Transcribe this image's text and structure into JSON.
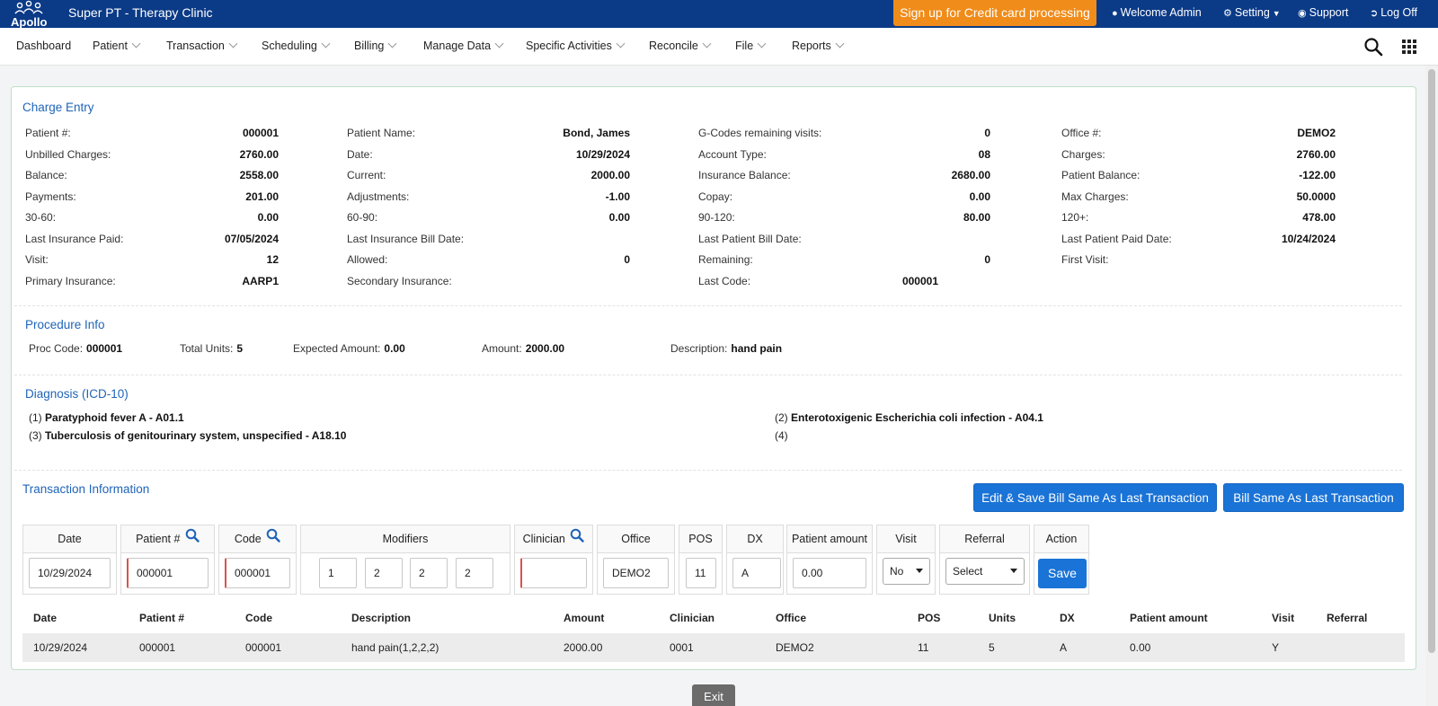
{
  "app": {
    "brand": "Apollo",
    "title": "Super PT - Therapy Clinic"
  },
  "topbar": {
    "signup_label": "Sign up for Credit card processing",
    "welcome": "Welcome Admin",
    "setting": "Setting",
    "support": "Support",
    "logoff": "Log Off"
  },
  "nav": [
    "Dashboard",
    "Patient",
    "Transaction",
    "Scheduling",
    "Billing",
    "Manage Data",
    "Specific Activities",
    "Reconcile",
    "File",
    "Reports"
  ],
  "charge_entry": {
    "title": "Charge Entry",
    "col1": [
      {
        "label": "Patient #:",
        "value": "000001"
      },
      {
        "label": "Unbilled Charges:",
        "value": "2760.00"
      },
      {
        "label": "Balance:",
        "value": "2558.00"
      },
      {
        "label": "Payments:",
        "value": "201.00"
      },
      {
        "label": "30-60:",
        "value": "0.00"
      },
      {
        "label": "Last Insurance Paid:",
        "value": "07/05/2024"
      },
      {
        "label": "Visit:",
        "value": "12"
      },
      {
        "label": "Primary Insurance:",
        "value": "AARP1"
      }
    ],
    "col2": [
      {
        "label": "Patient Name:",
        "value": "Bond, James"
      },
      {
        "label": "Date:",
        "value": "10/29/2024"
      },
      {
        "label": "Current:",
        "value": "2000.00"
      },
      {
        "label": "Adjustments:",
        "value": "-1.00"
      },
      {
        "label": "60-90:",
        "value": "0.00"
      },
      {
        "label": "Last Insurance Bill Date:",
        "value": ""
      },
      {
        "label": "Allowed:",
        "value": "0"
      },
      {
        "label": "Secondary Insurance:",
        "value": ""
      }
    ],
    "col3": [
      {
        "label": "G-Codes remaining visits:",
        "value": "0"
      },
      {
        "label": "Account Type:",
        "value": "08"
      },
      {
        "label": "Insurance Balance:",
        "value": "2680.00"
      },
      {
        "label": "Copay:",
        "value": "0.00"
      },
      {
        "label": "90-120:",
        "value": "80.00"
      },
      {
        "label": "Last Patient Bill Date:",
        "value": ""
      },
      {
        "label": "Remaining:",
        "value": "0"
      },
      {
        "label": "Last Code:",
        "value": "000001"
      }
    ],
    "col4": [
      {
        "label": "Office #:",
        "value": "DEMO2"
      },
      {
        "label": "Charges:",
        "value": "2760.00"
      },
      {
        "label": "Patient Balance:",
        "value": "-122.00"
      },
      {
        "label": "Max Charges:",
        "value": "50.0000"
      },
      {
        "label": "120+:",
        "value": "478.00"
      },
      {
        "label": "Last Patient Paid Date:",
        "value": "10/24/2024"
      },
      {
        "label": "First Visit:",
        "value": ""
      }
    ]
  },
  "procedure": {
    "title": "Procedure Info",
    "items": [
      {
        "label": "Proc Code:",
        "value": "000001"
      },
      {
        "label": "Total Units:",
        "value": "5"
      },
      {
        "label": "Expected Amount:",
        "value": "0.00"
      },
      {
        "label": "Amount:",
        "value": "2000.00"
      },
      {
        "label": "Description:",
        "value": "hand pain"
      }
    ]
  },
  "diagnosis": {
    "title": "Diagnosis (ICD-10)",
    "items": [
      {
        "num": "(1)",
        "text": "Paratyphoid fever A - A01.1"
      },
      {
        "num": "(2)",
        "text": "Enterotoxigenic Escherichia coli infection - A04.1"
      },
      {
        "num": "(3)",
        "text": "Tuberculosis of genitourinary system, unspecified - A18.10"
      },
      {
        "num": "(4)",
        "text": ""
      }
    ]
  },
  "transaction": {
    "title": "Transaction Information",
    "btn_edit_save": "Edit & Save Bill Same As Last Transaction",
    "btn_bill_same": "Bill Same As Last Transaction",
    "headers": {
      "date": "Date",
      "patient": "Patient #",
      "code": "Code",
      "modifiers": "Modifiers",
      "clinician": "Clinician",
      "office": "Office",
      "pos": "POS",
      "dx": "DX",
      "patient_amount": "Patient amount",
      "visit": "Visit",
      "referral": "Referral",
      "action": "Action"
    },
    "values": {
      "date": "10/29/2024",
      "patient": "000001",
      "code": "000001",
      "modifiers": [
        "1",
        "2",
        "2",
        "2"
      ],
      "clinician": "",
      "office": "DEMO2",
      "pos": "11",
      "dx": "A",
      "patient_amount": "0.00",
      "visit": "No",
      "referral": "Select"
    },
    "save_label": "Save"
  },
  "grid": {
    "headers": [
      "Date",
      "Patient #",
      "Code",
      "Description",
      "Amount",
      "Clinician",
      "Office",
      "POS",
      "Units",
      "DX",
      "Patient amount",
      "Visit",
      "Referral"
    ],
    "rows": [
      [
        "10/29/2024",
        "000001",
        "000001",
        "hand pain(1,2,2,2)",
        "2000.00",
        "0001",
        "DEMO2",
        "11",
        "5",
        "A",
        "0.00",
        "Y",
        ""
      ]
    ]
  },
  "exit_label": "Exit"
}
